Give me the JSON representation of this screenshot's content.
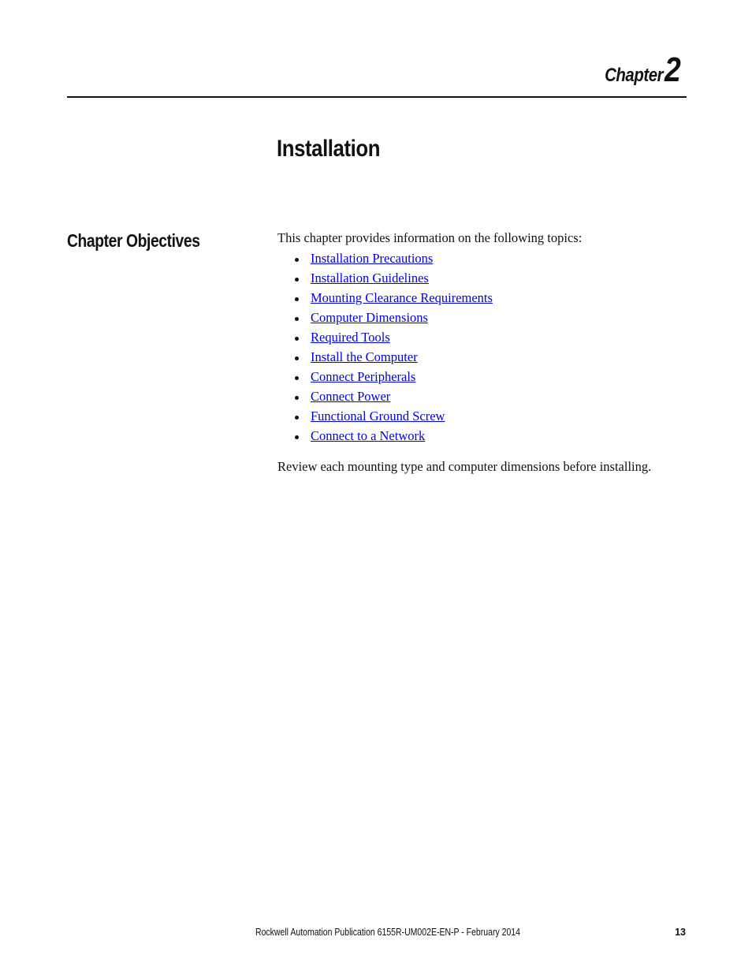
{
  "header": {
    "chapter_word": "Chapter",
    "chapter_number": "2"
  },
  "page_title": "Installation",
  "section": {
    "title": "Chapter Objectives",
    "intro": "This chapter provides information on the following topics:",
    "topics": [
      "Installation Precautions",
      "Installation Guidelines",
      "Mounting Clearance Requirements",
      "Computer Dimensions",
      "Required Tools",
      "Install the Computer",
      "Connect Peripherals",
      "Connect Power",
      "Functional Ground Screw",
      "Connect to a Network"
    ],
    "outro": "Review each mounting type and computer dimensions before installing."
  },
  "footer": {
    "publication": "Rockwell Automation Publication 6155R-UM002E-EN-P - February 2014",
    "page_number": "13"
  },
  "colors": {
    "link": "#0000ee",
    "text": "#111111"
  }
}
